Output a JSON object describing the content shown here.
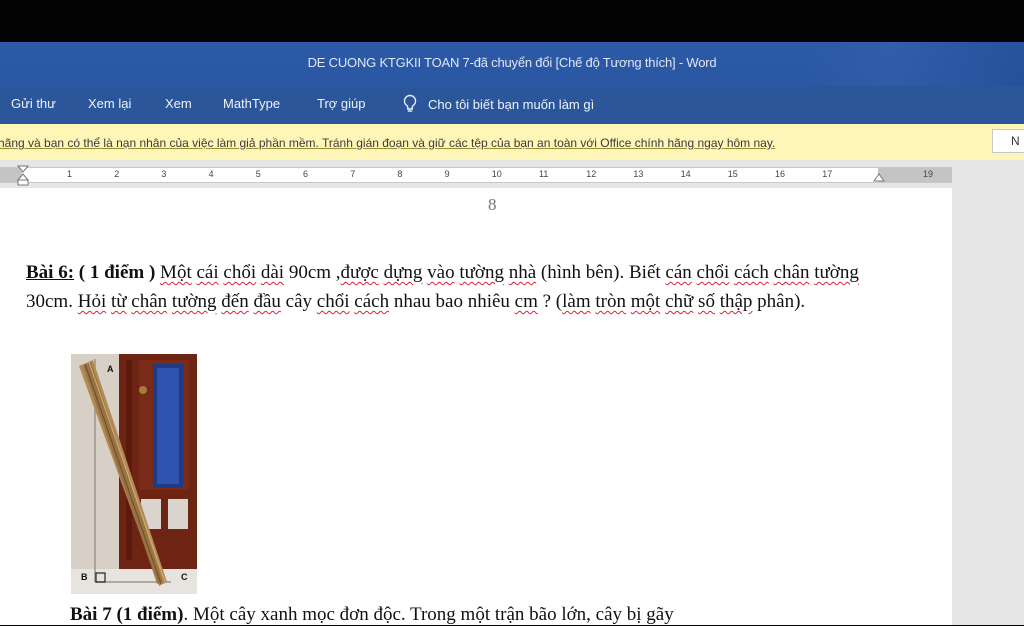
{
  "window": {
    "title": "DE CUONG KTGKII TOAN 7-đã chuyển đổi [Chế độ Tương thích]  -  Word"
  },
  "menu": {
    "items": [
      "Gửi thư",
      "Xem lại",
      "Xem",
      "MathType",
      "Trợ giúp"
    ],
    "tell_me": "Cho tôi biết bạn muốn làm gì",
    "tell_me_icon": "lightbulb-icon"
  },
  "warning": {
    "text": "hãng và bạn có thể là nạn nhân của việc làm giả phần mềm. Tránh gián đoạn và giữ các tệp của bạn an toàn với Office chính hãng ngay hôm nay.",
    "button": "N"
  },
  "ruler": {
    "numbers": [
      "1",
      "2",
      "3",
      "4",
      "5",
      "6",
      "7",
      "8",
      "9",
      "10",
      "11",
      "12",
      "13",
      "14",
      "15",
      "16",
      "17",
      "19"
    ]
  },
  "document": {
    "page_number": "8",
    "problem6": {
      "label": "Bài 6:",
      "points": " ( 1 điểm )",
      "words": [
        {
          "t": " "
        },
        {
          "t": "Một",
          "s": 1
        },
        {
          "t": " "
        },
        {
          "t": "cái",
          "s": 1
        },
        {
          "t": " "
        },
        {
          "t": "chổi",
          "s": 1
        },
        {
          "t": " "
        },
        {
          "t": "dài",
          "s": 1
        },
        {
          "t": " 90cm ,"
        },
        {
          "t": "được",
          "s": 1
        },
        {
          "t": " "
        },
        {
          "t": "dựng",
          "s": 1
        },
        {
          "t": " "
        },
        {
          "t": "vào",
          "s": 1
        },
        {
          "t": " "
        },
        {
          "t": "tường",
          "s": 1
        },
        {
          "t": " "
        },
        {
          "t": "nhà",
          "s": 1
        },
        {
          "t": " (hình bên). Biết "
        },
        {
          "t": "cán",
          "s": 1
        },
        {
          "t": " "
        },
        {
          "t": "chổi",
          "s": 1
        },
        {
          "t": " "
        },
        {
          "t": "cách",
          "s": 1
        },
        {
          "t": " "
        },
        {
          "t": "chân",
          "s": 1
        },
        {
          "t": " "
        },
        {
          "t": "tường",
          "s": 1
        },
        {
          "t": " 30cm. "
        },
        {
          "t": "Hỏi",
          "s": 1
        },
        {
          "t": " "
        },
        {
          "t": "từ",
          "s": 1
        },
        {
          "t": " "
        },
        {
          "t": "chân",
          "s": 1
        },
        {
          "t": " "
        },
        {
          "t": "tường",
          "s": 1
        },
        {
          "t": " "
        },
        {
          "t": "đến",
          "s": 1
        },
        {
          "t": " "
        },
        {
          "t": "đầu",
          "s": 1
        },
        {
          "t": " cây "
        },
        {
          "t": "chổi",
          "s": 1
        },
        {
          "t": " "
        },
        {
          "t": "cách",
          "s": 1
        },
        {
          "t": " nhau  bao nhiêu "
        },
        {
          "t": "cm",
          "s": 1
        },
        {
          "t": " ? ("
        },
        {
          "t": "làm",
          "s": 1
        },
        {
          "t": " "
        },
        {
          "t": "tròn",
          "s": 1
        },
        {
          "t": " "
        },
        {
          "t": "một",
          "s": 1
        },
        {
          "t": " "
        },
        {
          "t": "chữ",
          "s": 1
        },
        {
          "t": " "
        },
        {
          "t": "số",
          "s": 1
        },
        {
          "t": " "
        },
        {
          "t": "thập",
          "s": 1
        },
        {
          "t": " phân)."
        }
      ]
    },
    "figure_labels": {
      "a": "A",
      "b": "B",
      "c": "C"
    },
    "problem7": {
      "label": "Bài 7 (1 điểm)",
      "text": ". Một cây xanh mọc đơn độc. Trong một trận bão lớn, cây bị gãy"
    }
  }
}
